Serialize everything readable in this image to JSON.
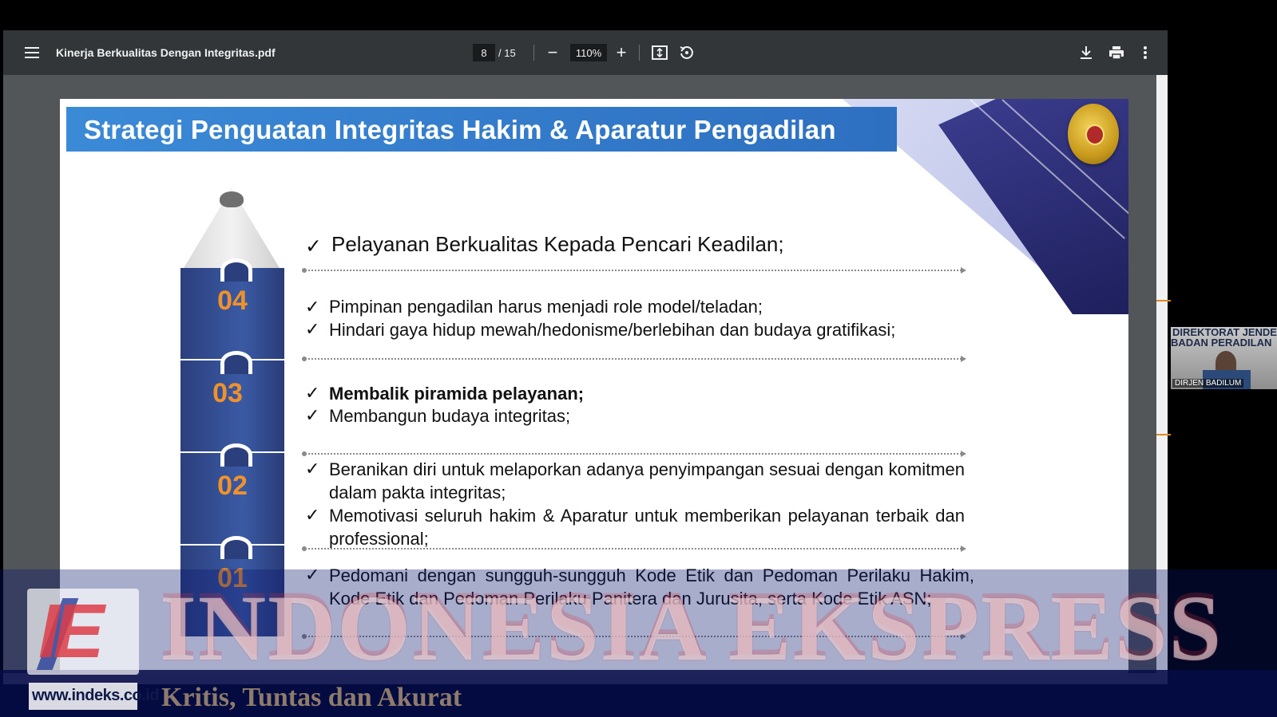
{
  "viewer": {
    "file_name": "Kinerja Berkualitas Dengan Integritas.pdf",
    "current_page": "8",
    "total_pages": "/ 15",
    "zoom": "110%",
    "zoom_out_symbol": "−",
    "zoom_in_symbol": "+",
    "icons": [
      "menu-icon",
      "fit-page-icon",
      "rotate-icon",
      "download-icon",
      "print-icon",
      "more-vertical-icon"
    ]
  },
  "slide": {
    "title": "Strategi Penguatan Integritas Hakim & Aparatur Pengadilan",
    "check_mark": "✓",
    "levels": [
      {
        "number": "04"
      },
      {
        "number": "03"
      },
      {
        "number": "02"
      },
      {
        "number": "01"
      }
    ],
    "headline": "Pelayanan Berkualitas Kepada Pencari Keadilan;",
    "group_04": [
      "Pimpinan pengadilan harus menjadi role model/teladan;",
      "Hindari gaya hidup mewah/hedonisme/berlebihan dan budaya gratifikasi;"
    ],
    "group_03": [
      "Membalik piramida pelayanan;",
      "Membangun budaya integritas;"
    ],
    "group_02": [
      "Beranikan diri untuk melaporkan adanya penyimpangan sesuai dengan komitmen dalam pakta integritas;",
      "Memotivasi seluruh hakim & Aparatur untuk memberikan pelayanan terbaik dan professional;"
    ],
    "group_01": [
      "Pedomani dengan sungguh-sungguh Kode Etik dan Pedoman Perilaku Hakim, Kode Etik dan Pedoman Perilaku Panitera dan Jurusita, serta Kode Etik ASN;"
    ]
  },
  "video": {
    "banner_line1": "DIREKTORAT JENDERAL",
    "banner_line2": "BADAN PERADILAN",
    "label": "DIRJEN BADILUM"
  },
  "watermark": {
    "logo_letters": "IE",
    "brand": "INDONESIA EKSPRESS",
    "url": "www.indeks.co.id",
    "tagline": "Kritis, Tuntas dan Akurat"
  },
  "colors": {
    "toolbar": "#323639",
    "title_band": "#3b8ad7",
    "pencil_body": "#2c3f7d",
    "level_number": "#f0922b",
    "overlay": "#0a146e"
  }
}
